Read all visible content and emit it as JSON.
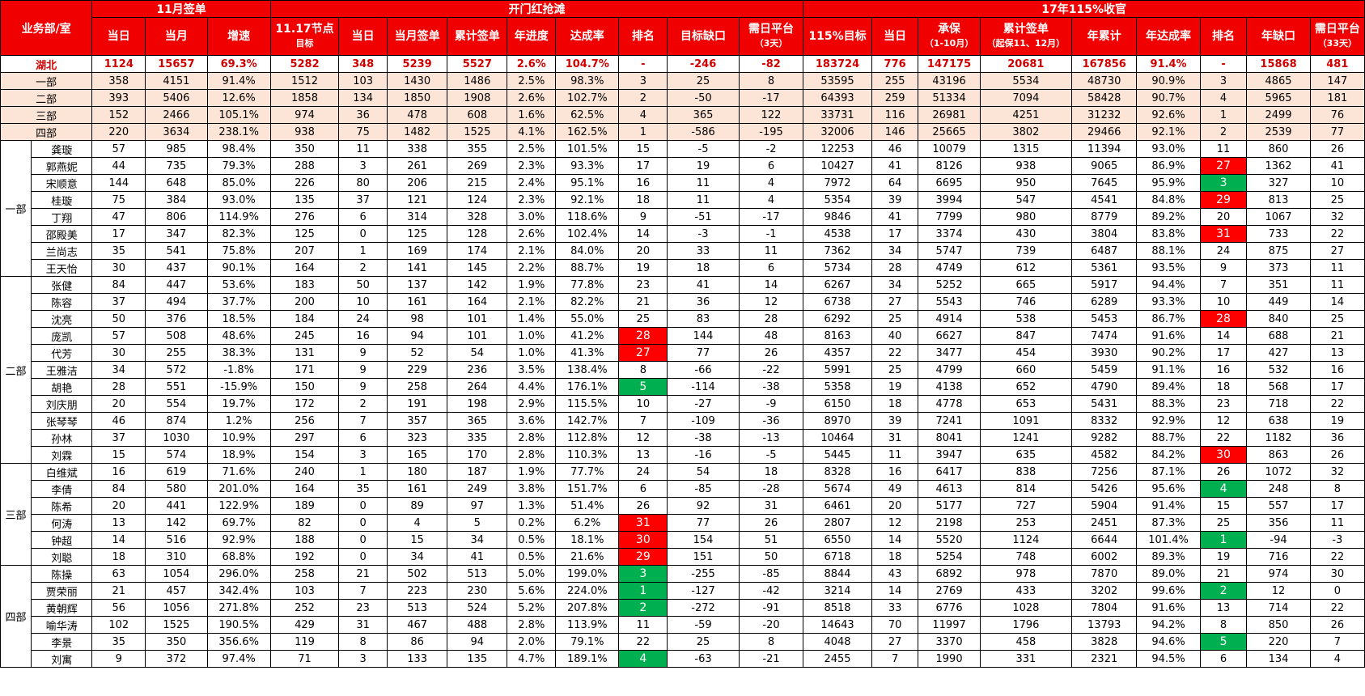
{
  "header": {
    "dept_room": "业务部/室",
    "group_nov": "11月签单",
    "group_kaimen": "开门红抢滩",
    "group_17": "17年115%收官",
    "cols": [
      "当日",
      "当月",
      "增速",
      "11.17节点目标",
      "当日",
      "当月签单",
      "累计签单",
      "年进度",
      "达成率",
      "排名",
      "目标缺口",
      "需日平台(3天)",
      "115%目标",
      "当日",
      "承保(1-10月)",
      "累计签单(起保11、12月)",
      "年累计",
      "年达成率",
      "排名",
      "年缺口",
      "需日平台(33天)"
    ],
    "col_main": [
      "当日",
      "当月",
      "增速",
      "11.17节点",
      "当日",
      "当月签单",
      "累计签单",
      "年进度",
      "达成率",
      "排名",
      "目标缺口",
      "需日平台",
      "115%目标",
      "当日",
      "承保",
      "累计签单",
      "年累计",
      "年达成率",
      "排名",
      "年缺口",
      "需日平台"
    ],
    "col_sub": [
      "",
      "",
      "",
      "目标",
      "",
      "",
      "",
      "",
      "",
      "",
      "",
      "（3天）",
      "",
      "",
      "（1-10月）",
      "（起保11、12月）",
      "",
      "",
      "",
      "",
      "（33天）"
    ]
  },
  "total": {
    "name": "湖北",
    "v": [
      "1124",
      "15657",
      "69.3%",
      "5282",
      "348",
      "5239",
      "5527",
      "2.6%",
      "104.7%",
      "-",
      "-246",
      "-82",
      "183724",
      "776",
      "147175",
      "20681",
      "167856",
      "91.4%",
      "-",
      "15868",
      "481"
    ]
  },
  "departments": [
    {
      "name": "一部",
      "v": [
        "358",
        "4151",
        "91.4%",
        "1512",
        "103",
        "1430",
        "1486",
        "2.5%",
        "98.3%",
        "3",
        "25",
        "8",
        "53595",
        "255",
        "43196",
        "5534",
        "48730",
        "90.9%",
        "3",
        "4865",
        "147"
      ]
    },
    {
      "name": "二部",
      "v": [
        "393",
        "5406",
        "12.6%",
        "1858",
        "134",
        "1850",
        "1908",
        "2.6%",
        "102.7%",
        "2",
        "-50",
        "-17",
        "64393",
        "259",
        "51334",
        "7094",
        "58428",
        "90.7%",
        "4",
        "5965",
        "181"
      ]
    },
    {
      "name": "三部",
      "v": [
        "152",
        "2466",
        "105.1%",
        "974",
        "36",
        "478",
        "608",
        "1.6%",
        "62.5%",
        "4",
        "365",
        "122",
        "33731",
        "116",
        "26981",
        "4251",
        "31232",
        "92.6%",
        "1",
        "2499",
        "76"
      ]
    },
    {
      "name": "四部",
      "v": [
        "220",
        "3634",
        "238.1%",
        "938",
        "75",
        "1482",
        "1525",
        "4.1%",
        "162.5%",
        "1",
        "-586",
        "-195",
        "32006",
        "146",
        "25665",
        "3802",
        "29466",
        "92.1%",
        "2",
        "2539",
        "77"
      ]
    }
  ],
  "groups": [
    {
      "label": "一部",
      "people": [
        {
          "name": "龚璇",
          "v": [
            "57",
            "985",
            "98.4%",
            "350",
            "11",
            "338",
            "355",
            "2.5%",
            "101.5%",
            "15",
            "-5",
            "-2",
            "12253",
            "46",
            "10079",
            "1315",
            "11394",
            "93.0%",
            "11",
            "860",
            "26"
          ]
        },
        {
          "name": "郭燕妮",
          "v": [
            "44",
            "735",
            "79.3%",
            "288",
            "3",
            "261",
            "269",
            "2.3%",
            "93.3%",
            "17",
            "19",
            "6",
            "10427",
            "41",
            "8126",
            "938",
            "9065",
            "86.9%",
            "27",
            "1362",
            "41"
          ]
        },
        {
          "name": "宋顺意",
          "v": [
            "144",
            "648",
            "85.0%",
            "226",
            "80",
            "206",
            "215",
            "2.4%",
            "95.1%",
            "16",
            "11",
            "4",
            "7972",
            "64",
            "6695",
            "950",
            "7645",
            "95.9%",
            "3",
            "327",
            "10"
          ]
        },
        {
          "name": "桂璇",
          "v": [
            "75",
            "384",
            "93.0%",
            "135",
            "37",
            "121",
            "124",
            "2.3%",
            "92.1%",
            "18",
            "11",
            "4",
            "5354",
            "39",
            "3994",
            "547",
            "4541",
            "84.8%",
            "29",
            "813",
            "25"
          ]
        },
        {
          "name": "丁翔",
          "v": [
            "47",
            "806",
            "114.9%",
            "276",
            "6",
            "314",
            "328",
            "3.0%",
            "118.6%",
            "9",
            "-51",
            "-17",
            "9846",
            "41",
            "7799",
            "980",
            "8779",
            "89.2%",
            "20",
            "1067",
            "32"
          ]
        },
        {
          "name": "邵殿美",
          "v": [
            "17",
            "347",
            "82.3%",
            "125",
            "0",
            "125",
            "128",
            "2.6%",
            "102.4%",
            "14",
            "-3",
            "-1",
            "4538",
            "17",
            "3374",
            "430",
            "3804",
            "83.8%",
            "31",
            "733",
            "22"
          ]
        },
        {
          "name": "兰尚志",
          "v": [
            "35",
            "541",
            "75.8%",
            "207",
            "1",
            "169",
            "174",
            "2.1%",
            "84.0%",
            "20",
            "33",
            "11",
            "7362",
            "34",
            "5747",
            "739",
            "6487",
            "88.1%",
            "24",
            "875",
            "27"
          ]
        },
        {
          "name": "王天怡",
          "v": [
            "30",
            "437",
            "90.1%",
            "164",
            "2",
            "141",
            "145",
            "2.2%",
            "88.7%",
            "19",
            "18",
            "6",
            "5734",
            "28",
            "4749",
            "612",
            "5361",
            "93.5%",
            "9",
            "373",
            "11"
          ]
        }
      ]
    },
    {
      "label": "二部",
      "people": [
        {
          "name": "张健",
          "v": [
            "84",
            "447",
            "53.6%",
            "183",
            "50",
            "137",
            "142",
            "1.9%",
            "77.8%",
            "23",
            "41",
            "14",
            "6267",
            "34",
            "5252",
            "665",
            "5917",
            "94.4%",
            "7",
            "351",
            "11"
          ]
        },
        {
          "name": "陈容",
          "v": [
            "37",
            "494",
            "37.7%",
            "200",
            "10",
            "161",
            "164",
            "2.1%",
            "82.2%",
            "21",
            "36",
            "12",
            "6738",
            "27",
            "5543",
            "746",
            "6289",
            "93.3%",
            "10",
            "449",
            "14"
          ]
        },
        {
          "name": "沈亮",
          "v": [
            "50",
            "376",
            "18.5%",
            "184",
            "24",
            "98",
            "101",
            "1.4%",
            "55.0%",
            "25",
            "83",
            "28",
            "6292",
            "25",
            "4914",
            "538",
            "5453",
            "86.7%",
            "28",
            "840",
            "25"
          ]
        },
        {
          "name": "庞凯",
          "v": [
            "57",
            "508",
            "48.6%",
            "245",
            "16",
            "94",
            "101",
            "1.0%",
            "41.2%",
            "28",
            "144",
            "48",
            "8163",
            "40",
            "6627",
            "847",
            "7474",
            "91.6%",
            "14",
            "688",
            "21"
          ]
        },
        {
          "name": "代芳",
          "v": [
            "30",
            "255",
            "38.3%",
            "131",
            "9",
            "52",
            "54",
            "1.0%",
            "41.3%",
            "27",
            "77",
            "26",
            "4357",
            "22",
            "3477",
            "454",
            "3930",
            "90.2%",
            "17",
            "427",
            "13"
          ]
        },
        {
          "name": "王雅洁",
          "v": [
            "34",
            "572",
            "-1.8%",
            "171",
            "9",
            "229",
            "236",
            "3.5%",
            "138.4%",
            "8",
            "-66",
            "-22",
            "5991",
            "25",
            "4799",
            "660",
            "5459",
            "91.1%",
            "16",
            "532",
            "16"
          ]
        },
        {
          "name": "胡艳",
          "v": [
            "28",
            "551",
            "-15.9%",
            "150",
            "9",
            "258",
            "264",
            "4.4%",
            "176.1%",
            "5",
            "-114",
            "-38",
            "5358",
            "19",
            "4138",
            "652",
            "4790",
            "89.4%",
            "18",
            "568",
            "17"
          ]
        },
        {
          "name": "刘庆朋",
          "v": [
            "20",
            "554",
            "19.7%",
            "172",
            "2",
            "191",
            "198",
            "2.9%",
            "115.5%",
            "10",
            "-27",
            "-9",
            "6150",
            "18",
            "4778",
            "653",
            "5431",
            "88.3%",
            "23",
            "718",
            "22"
          ]
        },
        {
          "name": "张琴琴",
          "v": [
            "46",
            "874",
            "1.2%",
            "256",
            "7",
            "357",
            "365",
            "3.6%",
            "142.7%",
            "7",
            "-109",
            "-36",
            "8970",
            "39",
            "7241",
            "1091",
            "8332",
            "92.9%",
            "12",
            "638",
            "19"
          ]
        },
        {
          "name": "孙林",
          "v": [
            "37",
            "1030",
            "10.9%",
            "297",
            "6",
            "323",
            "335",
            "2.8%",
            "112.8%",
            "12",
            "-38",
            "-13",
            "10464",
            "31",
            "8041",
            "1241",
            "9282",
            "88.7%",
            "22",
            "1182",
            "36"
          ]
        },
        {
          "name": "刘霖",
          "v": [
            "15",
            "574",
            "18.9%",
            "154",
            "3",
            "165",
            "170",
            "2.8%",
            "110.3%",
            "13",
            "-16",
            "-5",
            "5445",
            "11",
            "3947",
            "635",
            "4582",
            "84.2%",
            "30",
            "863",
            "26"
          ]
        }
      ]
    },
    {
      "label": "三部",
      "people": [
        {
          "name": "白维斌",
          "v": [
            "16",
            "619",
            "71.6%",
            "240",
            "1",
            "180",
            "187",
            "1.9%",
            "77.7%",
            "24",
            "54",
            "18",
            "8328",
            "16",
            "6417",
            "838",
            "7256",
            "87.1%",
            "26",
            "1072",
            "32"
          ]
        },
        {
          "name": "李倩",
          "v": [
            "84",
            "580",
            "201.0%",
            "164",
            "35",
            "161",
            "249",
            "3.8%",
            "151.7%",
            "6",
            "-85",
            "-28",
            "5674",
            "49",
            "4613",
            "814",
            "5426",
            "95.6%",
            "4",
            "248",
            "8"
          ]
        },
        {
          "name": "陈希",
          "v": [
            "20",
            "441",
            "122.9%",
            "189",
            "0",
            "89",
            "97",
            "1.3%",
            "51.4%",
            "26",
            "92",
            "31",
            "6461",
            "20",
            "5177",
            "727",
            "5904",
            "91.4%",
            "15",
            "557",
            "17"
          ]
        },
        {
          "name": "何涛",
          "v": [
            "13",
            "142",
            "69.7%",
            "82",
            "0",
            "4",
            "5",
            "0.2%",
            "6.2%",
            "31",
            "77",
            "26",
            "2807",
            "12",
            "2198",
            "253",
            "2451",
            "87.3%",
            "25",
            "356",
            "11"
          ]
        },
        {
          "name": "钟超",
          "v": [
            "14",
            "516",
            "92.9%",
            "188",
            "0",
            "15",
            "34",
            "0.5%",
            "18.1%",
            "30",
            "154",
            "51",
            "6550",
            "14",
            "5520",
            "1124",
            "6644",
            "101.4%",
            "1",
            "-94",
            "-3"
          ]
        },
        {
          "name": "刘聪",
          "v": [
            "18",
            "310",
            "68.8%",
            "192",
            "0",
            "34",
            "41",
            "0.5%",
            "21.6%",
            "29",
            "151",
            "50",
            "6718",
            "18",
            "5254",
            "748",
            "6002",
            "89.3%",
            "19",
            "716",
            "22"
          ]
        }
      ]
    },
    {
      "label": "四部",
      "people": [
        {
          "name": "陈操",
          "v": [
            "63",
            "1054",
            "296.0%",
            "258",
            "21",
            "502",
            "513",
            "5.0%",
            "199.0%",
            "3",
            "-255",
            "-85",
            "8844",
            "43",
            "6892",
            "978",
            "7870",
            "89.0%",
            "21",
            "974",
            "30"
          ]
        },
        {
          "name": "贾荣丽",
          "v": [
            "21",
            "457",
            "342.4%",
            "103",
            "7",
            "223",
            "230",
            "5.6%",
            "224.0%",
            "1",
            "-127",
            "-42",
            "3214",
            "14",
            "2769",
            "433",
            "3202",
            "99.6%",
            "2",
            "12",
            "0"
          ]
        },
        {
          "name": "黄朝辉",
          "v": [
            "56",
            "1056",
            "271.8%",
            "252",
            "23",
            "513",
            "524",
            "5.2%",
            "207.8%",
            "2",
            "-272",
            "-91",
            "8518",
            "33",
            "6776",
            "1028",
            "7804",
            "91.6%",
            "13",
            "714",
            "22"
          ]
        },
        {
          "name": "喻华涛",
          "v": [
            "102",
            "1525",
            "190.5%",
            "429",
            "31",
            "467",
            "488",
            "2.8%",
            "113.9%",
            "11",
            "-59",
            "-20",
            "14643",
            "70",
            "11997",
            "1796",
            "13793",
            "94.2%",
            "8",
            "850",
            "26"
          ]
        },
        {
          "name": "李景",
          "v": [
            "35",
            "350",
            "356.6%",
            "119",
            "8",
            "86",
            "94",
            "2.0%",
            "79.1%",
            "22",
            "25",
            "8",
            "4048",
            "27",
            "3370",
            "458",
            "3828",
            "94.6%",
            "5",
            "220",
            "7"
          ]
        },
        {
          "name": "刘寓",
          "v": [
            "9",
            "372",
            "97.4%",
            "71",
            "3",
            "133",
            "135",
            "4.7%",
            "189.1%",
            "4",
            "-63",
            "-21",
            "2455",
            "7",
            "1990",
            "331",
            "2321",
            "94.5%",
            "6",
            "134",
            "4"
          ]
        }
      ]
    }
  ],
  "highlights": {
    "rank_col_kaimen": {
      "庞凯": "red",
      "代芳": "red",
      "胡艳": "green",
      "何涛": "red",
      "钟超": "red",
      "刘聪": "red",
      "陈操": "green",
      "贾荣丽": "green",
      "黄朝辉": "green",
      "刘寓": "green"
    },
    "rank_col_17": {
      "郭燕妮": "red",
      "宋顺意": "green",
      "桂璇": "red",
      "邵殿美": "red",
      "沈亮": "red",
      "刘霖": "red",
      "李倩": "green",
      "钟超": "green",
      "贾荣丽": "green",
      "李景": "green"
    }
  },
  "colors": {
    "header_bg": "#f00000",
    "dept_bg": "#fce4d6",
    "total_text": "#d10000",
    "hl_red": "#ff0000",
    "hl_green": "#00b050"
  }
}
